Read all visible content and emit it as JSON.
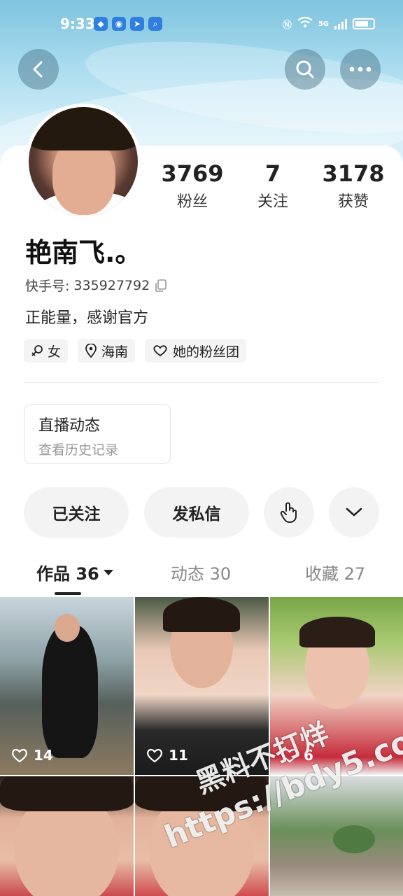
{
  "status_bar": {
    "time": "9:33",
    "network": "5G",
    "apps": [
      "app-icon",
      "app-icon",
      "app-icon",
      "app-icon"
    ]
  },
  "nav": {
    "back_icon": "chevron-left-icon",
    "search_icon": "search-icon",
    "more_icon": "more-dots-icon"
  },
  "profile": {
    "name": "艳南飞.。",
    "kuaishou_id_label": "快手号:",
    "kuaishou_id": "335927792",
    "bio": "正能量，感谢官方",
    "stats": [
      {
        "value": "3769",
        "label": "粉丝"
      },
      {
        "value": "7",
        "label": "关注"
      },
      {
        "value": "3178",
        "label": "获赞"
      }
    ],
    "tags": [
      {
        "icon": "female-icon",
        "text": "女"
      },
      {
        "icon": "location-icon",
        "text": "海南"
      },
      {
        "icon": "fan-club-icon",
        "text": "她的粉丝团"
      }
    ]
  },
  "live_card": {
    "title": "直播动态",
    "subtitle": "查看历史记录"
  },
  "actions": {
    "follow_label": "已关注",
    "message_label": "发私信"
  },
  "tabs": [
    {
      "label": "作品 36",
      "active": true
    },
    {
      "label": "动态 30",
      "active": false
    },
    {
      "label": "收藏 27",
      "active": false
    }
  ],
  "posts": [
    {
      "likes": "14"
    },
    {
      "likes": "11"
    },
    {
      "likes": "6"
    },
    {
      "likes": ""
    },
    {
      "likes": ""
    },
    {
      "likes": ""
    }
  ],
  "watermark": {
    "line1": "黑料不打烊",
    "line2": "https://bdy5.co"
  }
}
